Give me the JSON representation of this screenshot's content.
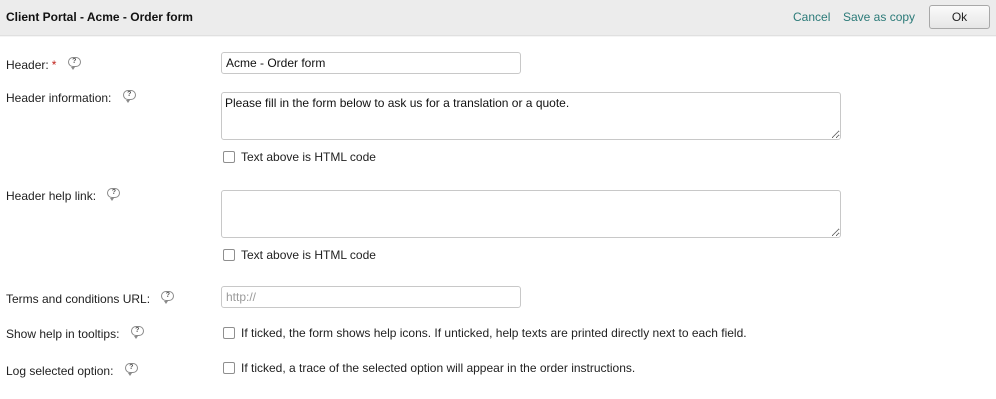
{
  "header": {
    "title": "Client Portal - Acme - Order form",
    "cancel_label": "Cancel",
    "save_copy_label": "Save as copy",
    "ok_label": "Ok"
  },
  "help_icon_glyph": "?",
  "form": {
    "header": {
      "label": "Header:",
      "required_mark": "*",
      "value": "Acme - Order form"
    },
    "header_information": {
      "label": "Header information:",
      "value": "Please fill in the form below to ask us for a translation or a quote.",
      "html_checkbox_label": "Text above is HTML code",
      "html_checked": false
    },
    "header_help_link": {
      "label": "Header help link:",
      "value": "",
      "html_checkbox_label": "Text above is HTML code",
      "html_checked": false
    },
    "terms_url": {
      "label": "Terms and conditions URL:",
      "value": "",
      "placeholder": "http://"
    },
    "show_help_tooltips": {
      "label": "Show help in tooltips:",
      "checkbox_label": "If ticked, the form shows help icons. If unticked, help texts are printed directly next to each field.",
      "checked": false
    },
    "log_selected_option": {
      "label": "Log selected option:",
      "checkbox_label": "If ticked, a trace of the selected option will appear in the order instructions.",
      "checked": false
    }
  }
}
